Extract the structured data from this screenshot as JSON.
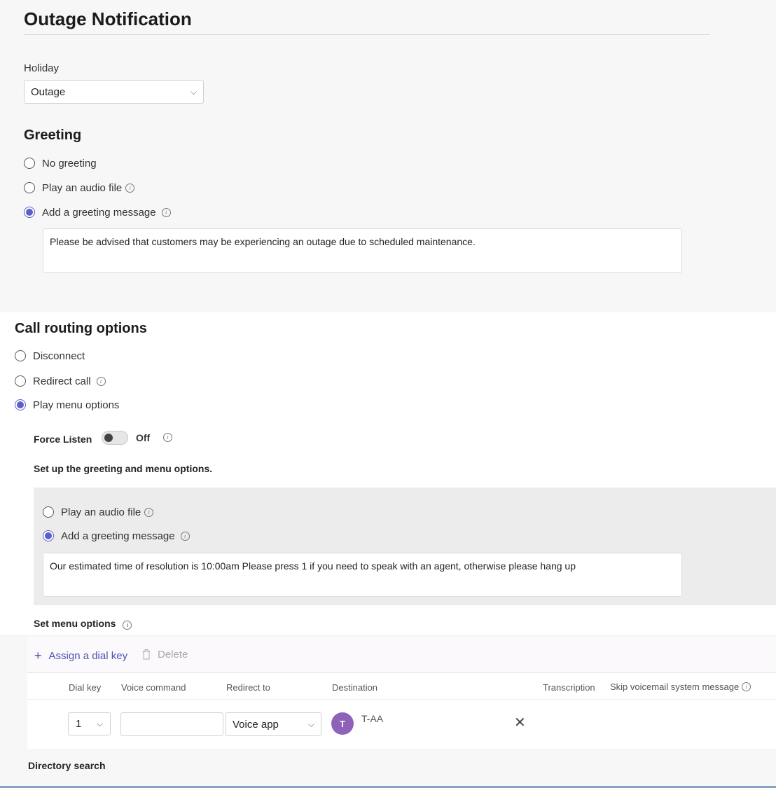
{
  "page": {
    "title": "Outage Notification"
  },
  "holiday": {
    "label": "Holiday",
    "selected": "Outage"
  },
  "greeting": {
    "heading": "Greeting",
    "options": [
      "No greeting",
      "Play an audio file",
      "Add a greeting message"
    ],
    "selected_index": 2,
    "message": "Please be advised that customers may be experiencing an outage due to scheduled maintenance."
  },
  "call_routing": {
    "heading": "Call routing options",
    "options": [
      "Disconnect",
      "Redirect call",
      "Play menu options"
    ],
    "selected_index": 2,
    "force_listen": {
      "label": "Force Listen",
      "state": "Off"
    },
    "setup_label": "Set up the greeting and menu options.",
    "menu_greeting": {
      "options": [
        "Play an audio file",
        "Add a greeting message"
      ],
      "selected_index": 1,
      "message": "Our estimated time of resolution is 10:00am Please press 1 if you need to speak with an agent, otherwise please hang up"
    },
    "set_menu_label": "Set menu options"
  },
  "menu_table": {
    "toolbar": {
      "assign_label": "Assign a dial key",
      "delete_label": "Delete"
    },
    "columns": [
      "Dial key",
      "Voice command",
      "Redirect to",
      "Destination",
      "Transcription",
      "Skip voicemail system message"
    ],
    "rows": [
      {
        "dial_key": "1",
        "voice_command": "",
        "redirect_to": "Voice app",
        "destination_initial": "T",
        "destination": "T-AA"
      }
    ]
  },
  "directory_search": {
    "label": "Directory search"
  },
  "colors": {
    "accent": "#5b5fc7",
    "avatar": "#8e62b8"
  }
}
